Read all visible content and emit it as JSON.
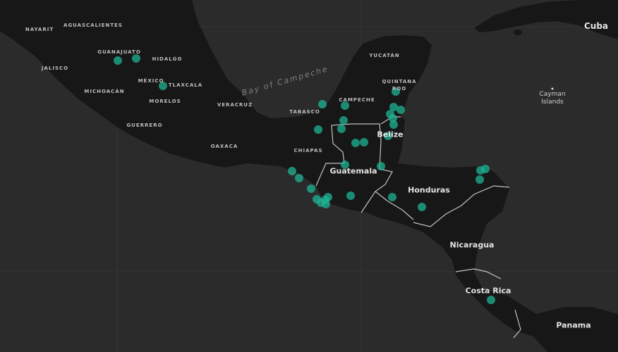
{
  "labels": {
    "states": [
      "NAYARIT",
      "AGUASCALIENTES",
      "GUANAJUATO",
      "HIDALGO",
      "JALISCO",
      "MÉXICO",
      "TLAXCALA",
      "MICHOACÁN",
      "MORELOS",
      "VERACRUZ",
      "GUERRERO",
      "OAXACA",
      "TABASCO",
      "CAMPECHE",
      "YUCATÁN",
      "QUINTANA",
      "ROO",
      "CHIAPAS"
    ],
    "countries": [
      "Belize",
      "Guatemala",
      "Honduras",
      "Nicaragua",
      "Costa Rica",
      "Panama",
      "Cuba"
    ],
    "water": "Bay of Campeche",
    "cayman_line1": "Cayman",
    "cayman_line2": "Islands"
  },
  "style": {
    "water_color": "#2b2b2c",
    "land_color": "#171717",
    "border_color": "#e0e0e0",
    "point_color": "#1fb394"
  },
  "points_count": 38
}
